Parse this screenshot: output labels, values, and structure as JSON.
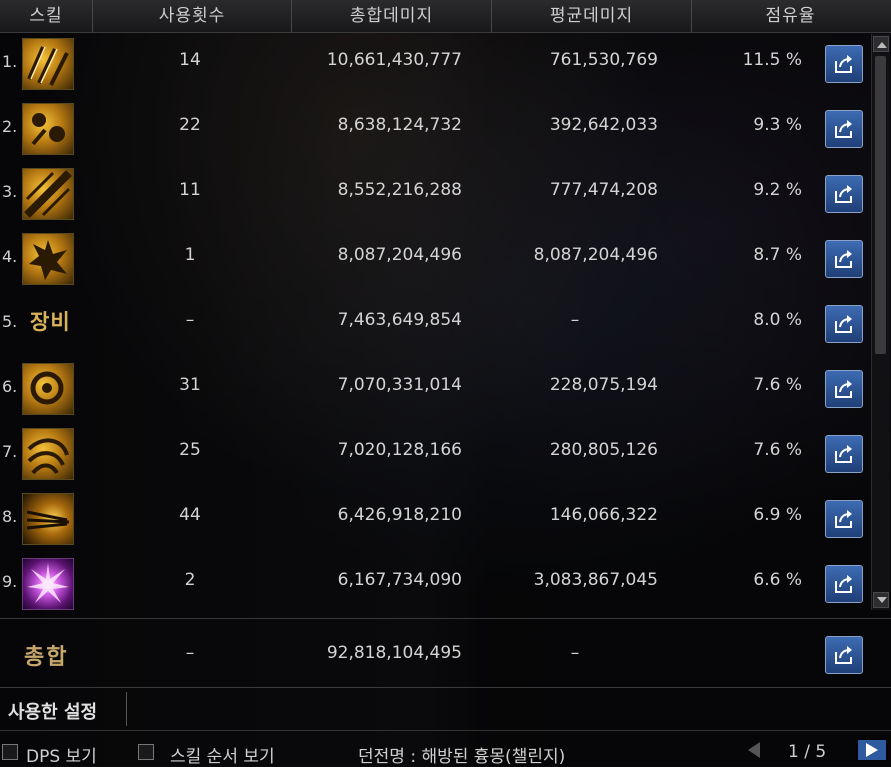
{
  "header": {
    "col_skill": "스킬",
    "col_count": "사용횟수",
    "col_total": "총합데미지",
    "col_avg": "평균데미지",
    "col_share": "점유율"
  },
  "rows": [
    {
      "rank": "1.",
      "count": "14",
      "total": "10,661,430,777",
      "avg": "761,530,769",
      "share": "11.5 %"
    },
    {
      "rank": "2.",
      "count": "22",
      "total": "8,638,124,732",
      "avg": "392,642,033",
      "share": "9.3 %"
    },
    {
      "rank": "3.",
      "count": "11",
      "total": "8,552,216,288",
      "avg": "777,474,208",
      "share": "9.2 %"
    },
    {
      "rank": "4.",
      "count": "1",
      "total": "8,087,204,496",
      "avg": "8,087,204,496",
      "share": "8.7 %"
    },
    {
      "rank": "5.",
      "equip": "장비",
      "count": "–",
      "total": "7,463,649,854",
      "avg": "–",
      "share": "8.0 %"
    },
    {
      "rank": "6.",
      "count": "31",
      "total": "7,070,331,014",
      "avg": "228,075,194",
      "share": "7.6 %"
    },
    {
      "rank": "7.",
      "count": "25",
      "total": "7,020,128,166",
      "avg": "280,805,126",
      "share": "7.6 %"
    },
    {
      "rank": "8.",
      "count": "44",
      "total": "6,426,918,210",
      "avg": "146,066,322",
      "share": "6.9 %"
    },
    {
      "rank": "9.",
      "count": "2",
      "total": "6,167,734,090",
      "avg": "3,083,867,045",
      "share": "6.6 %"
    }
  ],
  "summary": {
    "label": "총합",
    "count": "–",
    "total": "92,818,104,495",
    "avg": "–"
  },
  "settings": {
    "label": "사용한 설정"
  },
  "bottom": {
    "dps_label": "DPS 보기",
    "order_label": "스킬 순서 보기",
    "dungeon_text": "던전명 : 해방된 흉몽(챌린지)",
    "page": "1 / 5"
  },
  "colors": {
    "accent_blue": "#2f5aa0",
    "gold": "#d9b25a",
    "text": "#d4d4d4"
  },
  "icons": {
    "share": "share-export-icon",
    "scroll_up": "chevron-up-icon",
    "scroll_down": "chevron-down-icon"
  }
}
